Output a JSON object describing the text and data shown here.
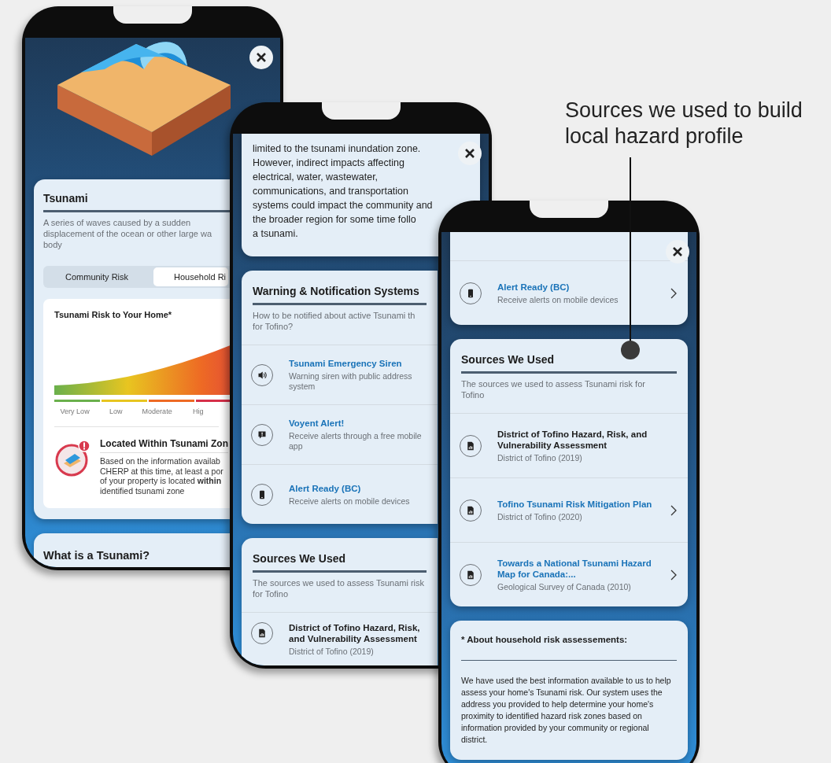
{
  "annotation": {
    "text": "Sources we used to build local hazard profile"
  },
  "phone_1": {
    "hazard": {
      "title": "Tsunami",
      "description_lines": [
        "A series of waves caused by a sudden",
        "displacement of the ocean or other large wa",
        "body"
      ],
      "tabs": [
        {
          "label": "Community Risk",
          "selected": false
        },
        {
          "label": "Household Ri",
          "selected": true
        }
      ],
      "chart_panel": {
        "title": "Tsunami Risk to Your Home*",
        "levels": [
          {
            "label": "Very Low",
            "color": "#6ab04c"
          },
          {
            "label": "Low",
            "color": "#e8c520"
          },
          {
            "label": "Moderate",
            "color": "#ee6a24"
          },
          {
            "label": "Hig",
            "color": "#d6304a"
          }
        ]
      },
      "zone_alert": {
        "title": "Located Within Tsunami Zon",
        "body_lines": [
          "Based on the information availab",
          "CHERP at this time, at least a por",
          "of your property is located **within**",
          "identified tsunami zone"
        ]
      }
    },
    "next_card": {
      "title": "What is a Tsunami?"
    }
  },
  "phone_2": {
    "intro_card": {
      "lines": [
        "limited to the tsunami inundation zone.",
        "However, indirect impacts affecting",
        "electrical, water, wastewater,",
        "communications, and transportation",
        "systems could impact the community and",
        "the broader region for some time follo",
        "a tsunami."
      ]
    },
    "warning_card": {
      "title": "Warning & Notification Systems",
      "subtitle_lines": [
        "How to be notified about active Tsunami th",
        "for Tofino?"
      ],
      "items": [
        {
          "kind": "speaker",
          "title": "Tsunami Emergency Siren",
          "description": "Warning siren with public address system"
        },
        {
          "kind": "alert",
          "title": "Voyent Alert!",
          "description": "Receive alerts through a free mobile app"
        },
        {
          "kind": "phone",
          "title": "Alert Ready (BC)",
          "description": "Receive alerts on mobile devices"
        }
      ]
    },
    "sources_card": {
      "title": "Sources We Used",
      "subtitle_lines": [
        "The sources we used to assess Tsunami risk",
        "for Tofino"
      ],
      "items": [
        {
          "kind": "document",
          "title": "District of Tofino Hazard, Risk, and Vulnerability Assessment",
          "source": "District of Tofino (2019)",
          "linked": false
        }
      ]
    }
  },
  "phone_3": {
    "top_card": {
      "items": [
        {
          "kind": "phone",
          "title": "Alert Ready (BC)",
          "description": "Receive alerts on mobile devices"
        }
      ]
    },
    "sources_card": {
      "title": "Sources We Used",
      "subtitle": "The sources we used to assess Tsunami risk for Tofino",
      "items": [
        {
          "kind": "document",
          "title": "District of Tofino Hazard, Risk, and Vulnerability Assessment",
          "source": "District of Tofino (2019)",
          "linked": false
        },
        {
          "kind": "document",
          "title": "Tofino Tsunami Risk Mitigation Plan",
          "source": "District of Tofino (2020)",
          "linked": true
        },
        {
          "kind": "document",
          "title": "Towards a National Tsunami Hazard Map for Canada:...",
          "source": "Geological Survey of Canada (2010)",
          "linked": true
        }
      ]
    },
    "about_card": {
      "title": "* About household risk assessements:",
      "body": "We have used the best information available to us to help assess your home's Tsunami risk. Our system uses the address you provided to help determine your home's proximity to identified hazard risk zones based on information provided by your community or regional district."
    }
  }
}
